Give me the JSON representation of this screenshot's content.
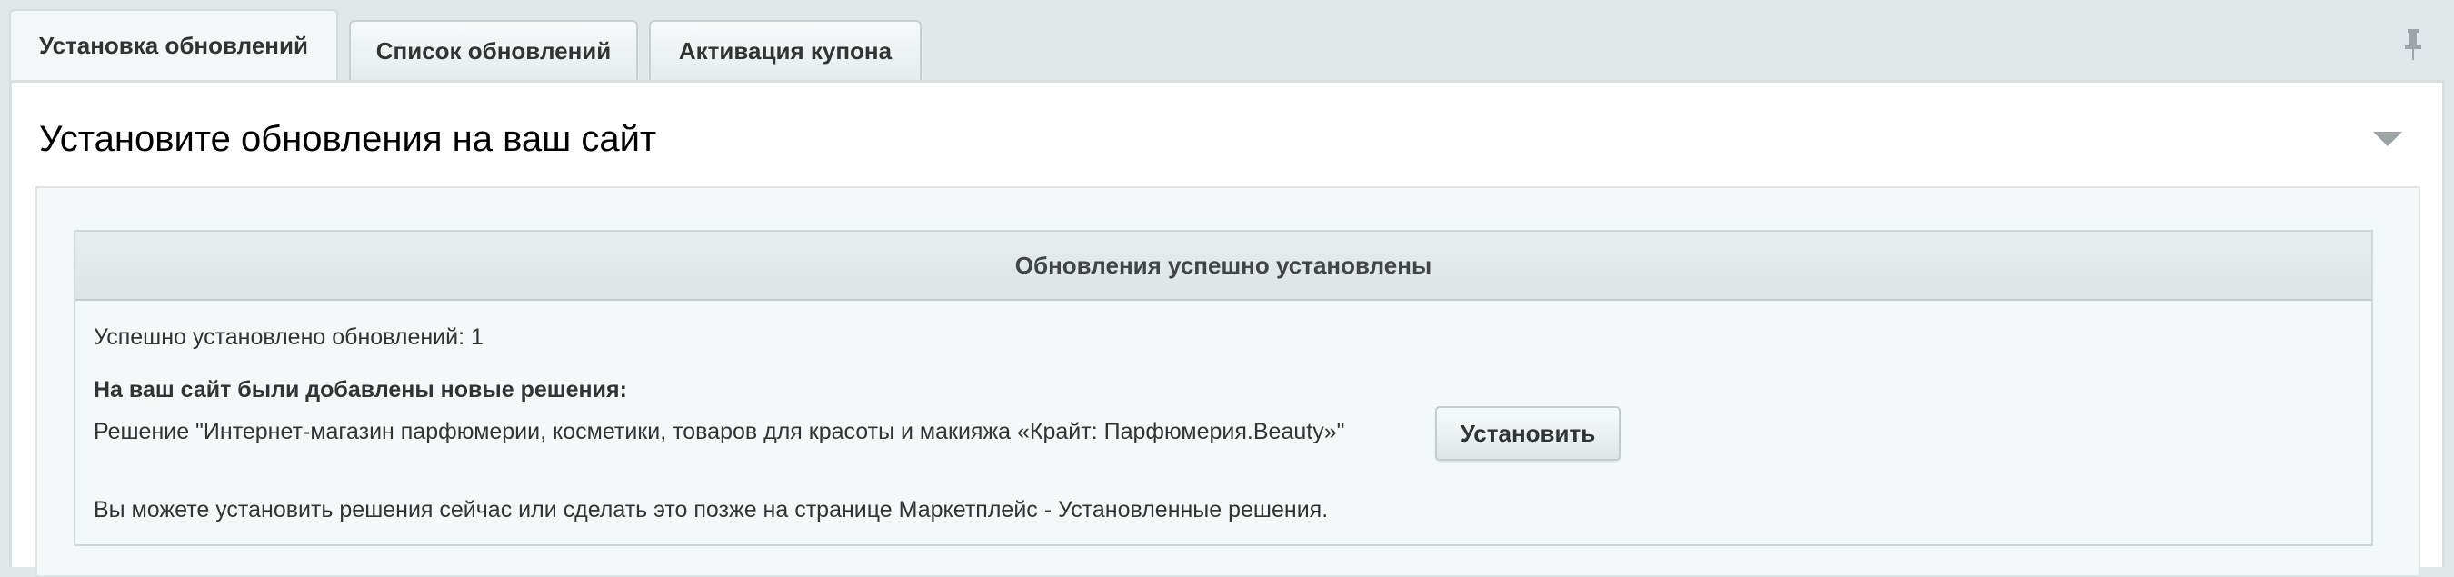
{
  "tabs": [
    {
      "label": "Установка обновлений"
    },
    {
      "label": "Список обновлений"
    },
    {
      "label": "Активация купона"
    }
  ],
  "panel": {
    "title": "Установите обновления на ваш сайт"
  },
  "notice": {
    "header": "Обновления успешно установлены",
    "installed_count_text": "Успешно установлено обновлений: 1",
    "new_solutions_heading": "На ваш сайт были добавлены новые решения:",
    "solution_text": "Решение \"Интернет-магазин парфюмерии, косметики, товаров для красоты и макияжа «Крайт: Парфюмерия.Beauty»\"",
    "install_button_label": "Установить",
    "footer_text": "Вы можете установить решения сейчас или сделать это позже на странице Маркетплейс - Установленные решения."
  },
  "icons": {
    "pin": "pin-icon",
    "collapse": "triangle-down-icon"
  },
  "colors": {
    "background": "#e0e8ea",
    "panel": "#ffffff",
    "notice_header": "#dce4e6"
  }
}
